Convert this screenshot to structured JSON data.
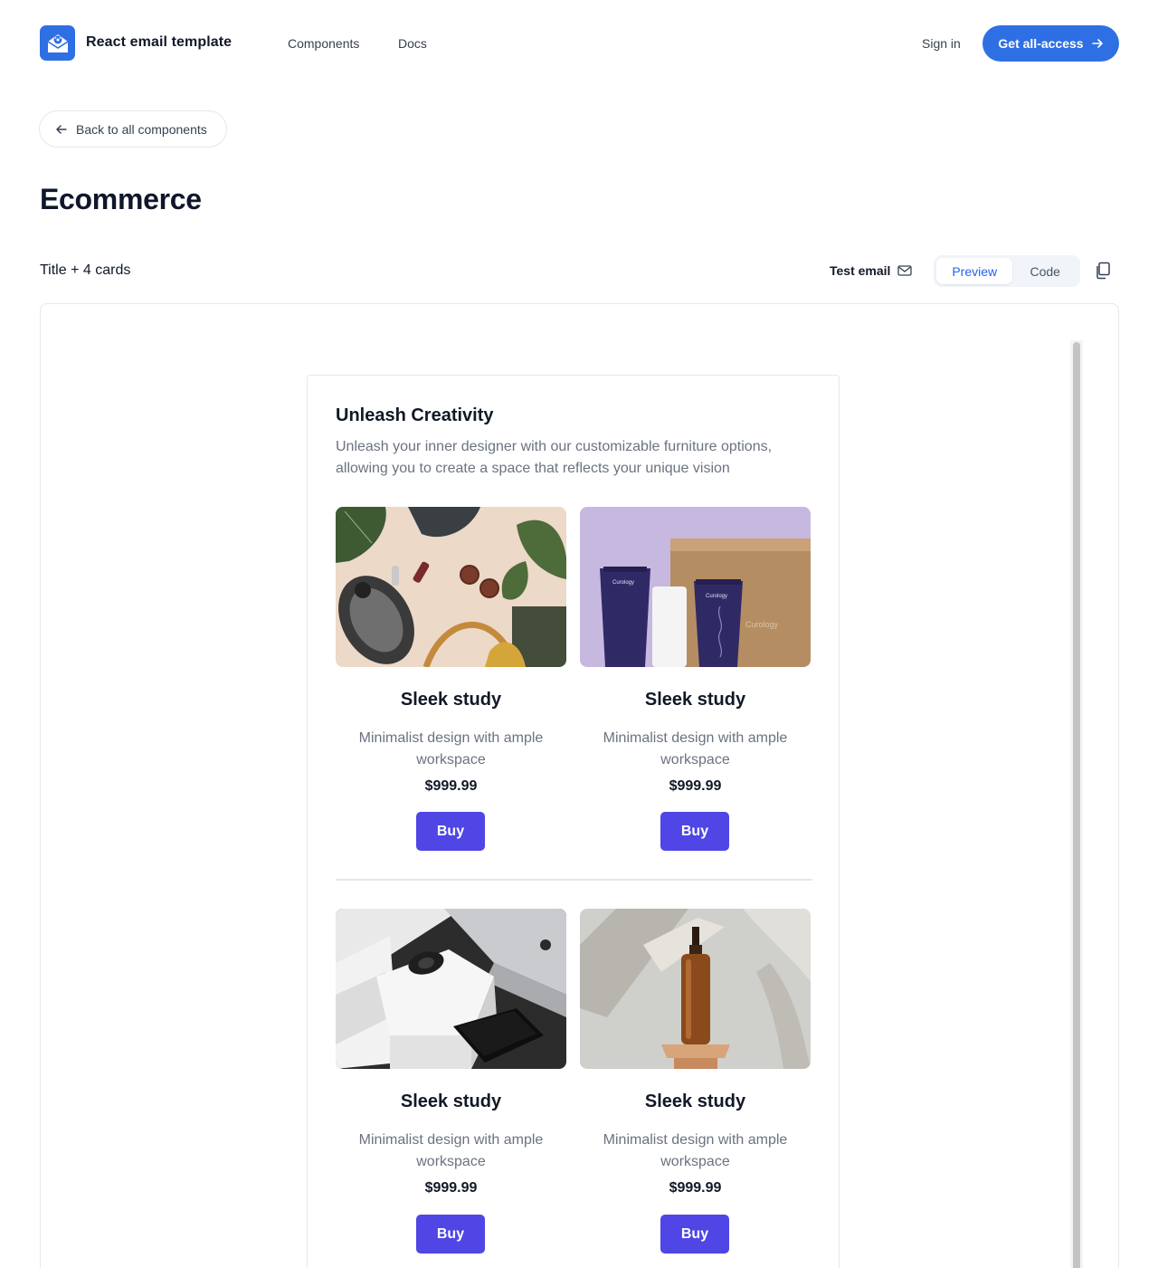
{
  "header": {
    "brand": "React email template",
    "nav": [
      "Components",
      "Docs"
    ],
    "sign_in": "Sign in",
    "cta": "Get all-access"
  },
  "back_label": "Back to all components",
  "page_title": "Ecommerce",
  "toolbar": {
    "variant": "Title + 4 cards",
    "test_email": "Test email",
    "tabs": {
      "preview": "Preview",
      "code": "Code"
    }
  },
  "email": {
    "title": "Unleash Creativity",
    "subtitle": "Unleash your inner designer with our customizable furniture options, allowing you to create a space that reflects your unique vision",
    "cards": [
      {
        "title": "Sleek study",
        "description": "Minimalist design with ample workspace",
        "price": "$999.99",
        "button": "Buy"
      },
      {
        "title": "Sleek study",
        "description": "Minimalist design with ample workspace",
        "price": "$999.99",
        "button": "Buy"
      },
      {
        "title": "Sleek study",
        "description": "Minimalist design with ample workspace",
        "price": "$999.99",
        "button": "Buy"
      },
      {
        "title": "Sleek study",
        "description": "Minimalist design with ample workspace",
        "price": "$999.99",
        "button": "Buy"
      }
    ],
    "product_labels": {
      "brand": "Curology"
    }
  },
  "colors": {
    "brand": "#2f6fe4",
    "buy_button": "#4f46e5",
    "active_tab": "#2563eb"
  }
}
